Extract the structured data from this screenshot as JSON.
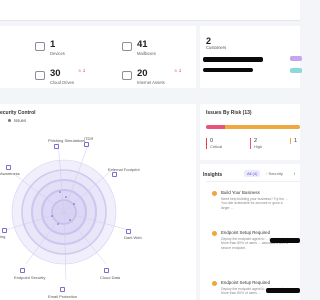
{
  "stats": [
    {
      "value": "1",
      "label": "Devices"
    },
    {
      "value": "41",
      "label": "Mailboxes"
    },
    {
      "value": "30",
      "label": "Cloud Drives",
      "warning": "1"
    },
    {
      "value": "20",
      "label": "Internet Assets",
      "warning": "1"
    }
  ],
  "customers": {
    "value": "2",
    "label": "Customers"
  },
  "security_control": {
    "title": "ecurity Control",
    "legend_label": "Issues",
    "axes": [
      "Phishing Simulations",
      "ITDR",
      "External Footprint",
      "Dark Web",
      "Cloud Data",
      "Email Protection",
      "Endpoint Security",
      "ing",
      "Awareness"
    ]
  },
  "issues_by_risk": {
    "title": "Issues By Risk (13)",
    "segments": [
      {
        "value": "0",
        "label": "Critical",
        "color": "#e0404a",
        "share": 0
      },
      {
        "value": "2",
        "label": "High",
        "color": "#e8557a",
        "share": 0.2
      },
      {
        "value": "1",
        "label": "",
        "color": "#f0a840",
        "share": 0.8
      }
    ]
  },
  "insights": {
    "title": "Insights",
    "tabs": [
      "All (4)",
      "Security",
      "I"
    ],
    "items": [
      {
        "title": "Build Your Business",
        "body": "Need help building your business? Try the ... You ride actionable for account or grow a larger ..."
      },
      {
        "title": "Endpoint Setup Required",
        "body": "Deploy the endpoint agent to ... protected. More than 80% of users ... associated with a secure endpoint."
      },
      {
        "title": "Endpoint Setup Required",
        "body": "Deploy the endpoint agent to ... protected. More than 80% of users ..."
      }
    ]
  }
}
